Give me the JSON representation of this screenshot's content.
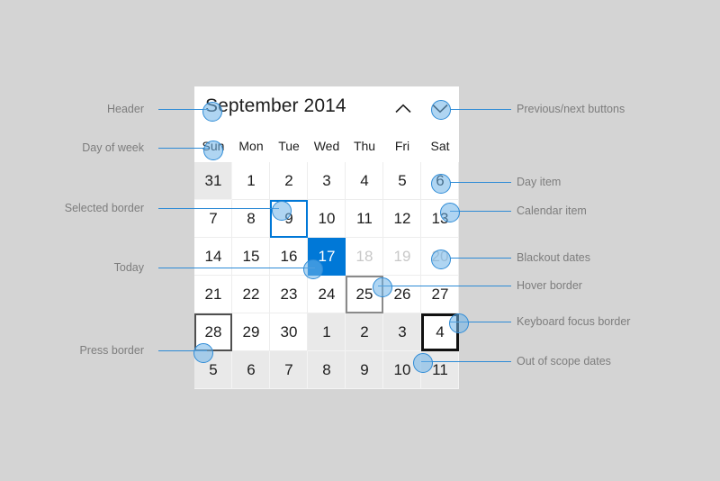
{
  "page": {
    "background_color": "#d4d4d4",
    "accent_color": "#0078d7",
    "callout_color": "#2e8bd6",
    "label_color": "#7d7d7d"
  },
  "calendar": {
    "title": "September 2014",
    "prev_button_icon": "chevron-up-icon",
    "next_button_icon": "chevron-down-icon",
    "day_of_week": [
      "Sun",
      "Mon",
      "Tue",
      "Wed",
      "Thu",
      "Fri",
      "Sat"
    ],
    "weeks": [
      [
        {
          "day": "31",
          "state": "outscope"
        },
        {
          "day": "1",
          "state": "normal"
        },
        {
          "day": "2",
          "state": "normal"
        },
        {
          "day": "3",
          "state": "normal"
        },
        {
          "day": "4",
          "state": "normal"
        },
        {
          "day": "5",
          "state": "normal"
        },
        {
          "day": "6",
          "state": "normal"
        }
      ],
      [
        {
          "day": "7",
          "state": "normal"
        },
        {
          "day": "8",
          "state": "normal"
        },
        {
          "day": "9",
          "state": "selected"
        },
        {
          "day": "10",
          "state": "normal"
        },
        {
          "day": "11",
          "state": "normal"
        },
        {
          "day": "12",
          "state": "normal"
        },
        {
          "day": "13",
          "state": "normal"
        }
      ],
      [
        {
          "day": "14",
          "state": "normal"
        },
        {
          "day": "15",
          "state": "normal"
        },
        {
          "day": "16",
          "state": "normal"
        },
        {
          "day": "17",
          "state": "today"
        },
        {
          "day": "18",
          "state": "blackout"
        },
        {
          "day": "19",
          "state": "blackout"
        },
        {
          "day": "20",
          "state": "blackout"
        }
      ],
      [
        {
          "day": "21",
          "state": "normal"
        },
        {
          "day": "22",
          "state": "normal"
        },
        {
          "day": "23",
          "state": "normal"
        },
        {
          "day": "24",
          "state": "normal"
        },
        {
          "day": "25",
          "state": "hover"
        },
        {
          "day": "26",
          "state": "normal"
        },
        {
          "day": "27",
          "state": "normal"
        }
      ],
      [
        {
          "day": "28",
          "state": "press"
        },
        {
          "day": "29",
          "state": "normal"
        },
        {
          "day": "30",
          "state": "normal"
        },
        {
          "day": "1",
          "state": "outscope"
        },
        {
          "day": "2",
          "state": "outscope"
        },
        {
          "day": "3",
          "state": "outscope"
        },
        {
          "day": "4",
          "state": "focus"
        }
      ],
      [
        {
          "day": "5",
          "state": "outscope"
        },
        {
          "day": "6",
          "state": "outscope"
        },
        {
          "day": "7",
          "state": "outscope"
        },
        {
          "day": "8",
          "state": "outscope"
        },
        {
          "day": "9",
          "state": "outscope"
        },
        {
          "day": "10",
          "state": "outscope"
        },
        {
          "day": "11",
          "state": "outscope"
        }
      ]
    ]
  },
  "annotations": {
    "left": [
      {
        "id": "header",
        "label": "Header"
      },
      {
        "id": "day-of-week",
        "label": "Day of week"
      },
      {
        "id": "selected-border",
        "label": "Selected border"
      },
      {
        "id": "today",
        "label": "Today"
      },
      {
        "id": "press-border",
        "label": "Press border"
      }
    ],
    "right": [
      {
        "id": "prev-next-buttons",
        "label": "Previous/next buttons"
      },
      {
        "id": "day-item",
        "label": "Day item"
      },
      {
        "id": "calendar-item",
        "label": "Calendar item"
      },
      {
        "id": "blackout-dates",
        "label": "Blackout dates"
      },
      {
        "id": "hover-border",
        "label": "Hover border"
      },
      {
        "id": "keyboard-focus-border",
        "label": "Keyboard focus border"
      },
      {
        "id": "out-of-scope-dates",
        "label": "Out of scope dates"
      }
    ]
  }
}
